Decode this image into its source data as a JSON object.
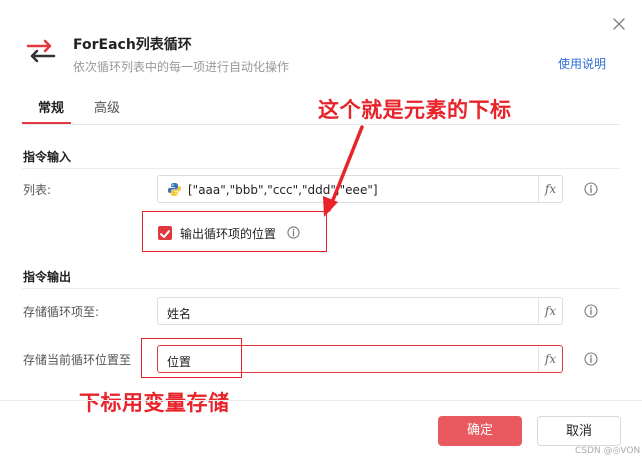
{
  "header": {
    "title": "ForEach列表循环",
    "subtitle": "依次循环列表中的每一项进行自动化操作",
    "help_link": "使用说明"
  },
  "tabs": [
    {
      "label": "常规",
      "active": true
    },
    {
      "label": "高级",
      "active": false
    }
  ],
  "annotations": {
    "top": "这个就是元素的下标",
    "bottom": "下标用变量存储"
  },
  "input_section": {
    "title": "指令输入",
    "list_label": "列表:",
    "list_value": "[\"aaa\",\"bbb\",\"ccc\",\"ddd\",\"eee\"]",
    "checkbox_label": "输出循环项的位置",
    "checkbox_checked": true
  },
  "output_section": {
    "title": "指令输出",
    "item_label": "存储循环项至:",
    "item_value": "姓名",
    "position_label": "存储当前循环位置至",
    "position_value": "位置"
  },
  "fx_label": "fx",
  "buttons": {
    "confirm": "确定",
    "cancel": "取消"
  },
  "watermark": "CSDN @◎VON",
  "colors": {
    "accent": "#e0383e",
    "annotation": "#e8232a",
    "link": "#2d6fd6"
  },
  "icons": {
    "app": "loop-arrows-icon",
    "close": "close-icon",
    "info": "info-icon",
    "python": "python-icon",
    "check": "check-icon"
  }
}
